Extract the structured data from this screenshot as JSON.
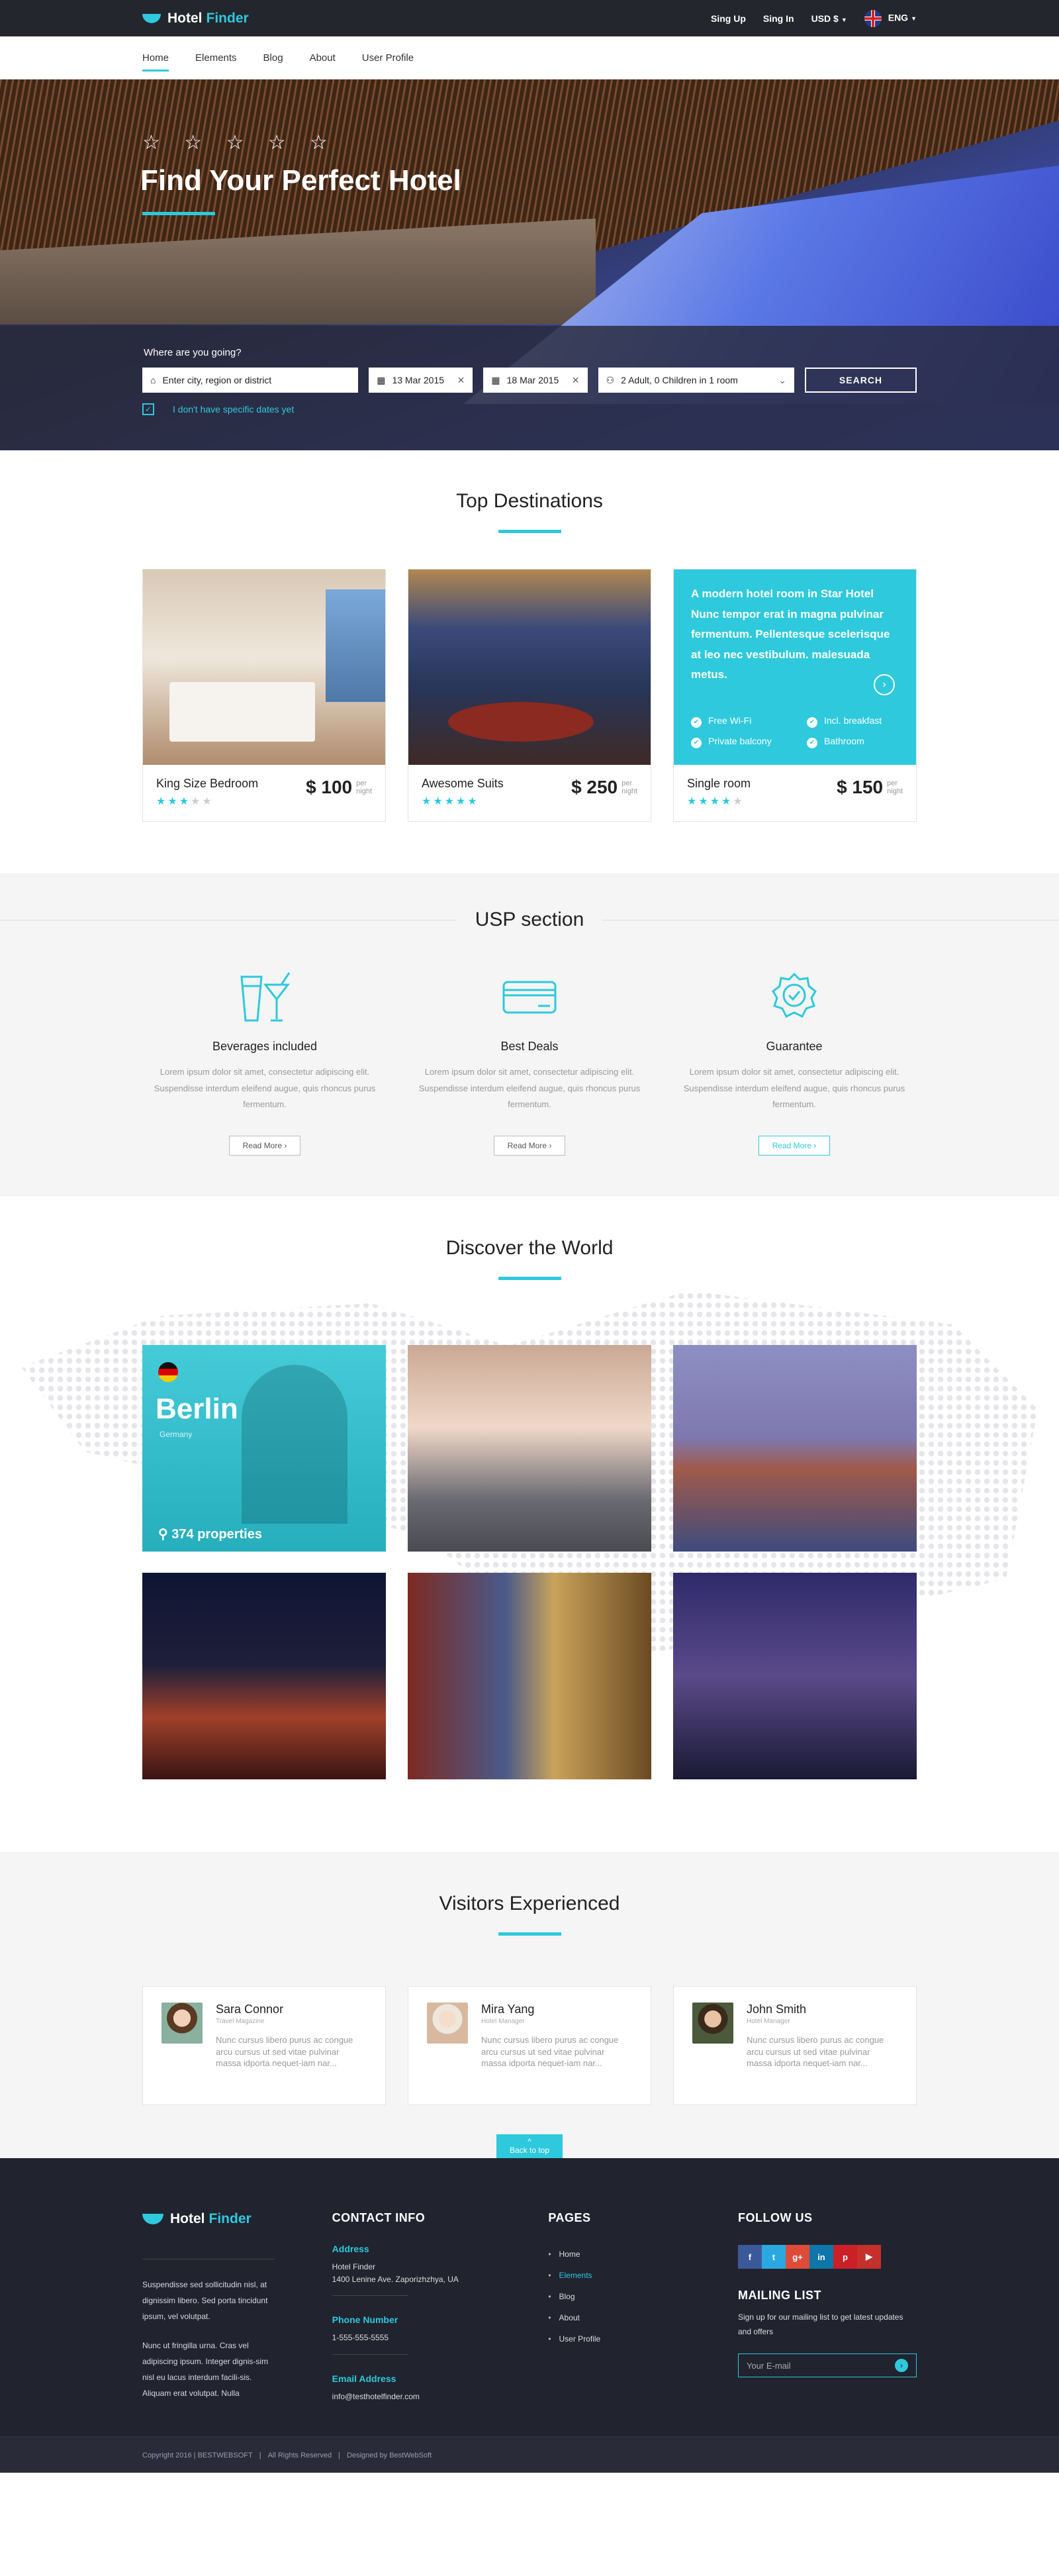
{
  "brand": {
    "name": "Hotel",
    "accent": "Finder",
    "accent_color": "#2ec9dc"
  },
  "topbar": {
    "sign_up": "Sing Up",
    "sign_in": "Sing In",
    "currency": "USD $",
    "language": "ENG"
  },
  "nav": {
    "items": [
      "Home",
      "Elements",
      "Blog",
      "About",
      "User Profile"
    ],
    "active": "Home"
  },
  "hero": {
    "stars": "☆ ☆ ☆ ☆ ☆",
    "title": "Find Your Perfect Hotel",
    "search": {
      "question": "Where are you going?",
      "destination_placeholder": "Enter city, region or district",
      "checkin": "13 Mar 2015",
      "checkout": "18 Mar 2015",
      "guests": "2 Adult, 0 Children in 1 room",
      "button": "SEARCH",
      "no_dates": "I don't have specific dates yet"
    }
  },
  "top_destinations": {
    "title": "Top Destinations",
    "cards": [
      {
        "name": "King Size Bedroom",
        "price": "$ 100",
        "per": "per",
        "night": "night",
        "rating": 3
      },
      {
        "name": "Awesome Suits",
        "price": "$ 250",
        "per": "per",
        "night": "night",
        "rating": 5
      },
      {
        "name": "Single room",
        "price": "$ 150",
        "per": "per",
        "night": "night",
        "rating": 4
      }
    ],
    "promo": {
      "text": "A modern hotel room in Star Hotel Nunc tempor erat in magna pulvinar fermentum. Pellentesque scelerisque at leo nec vestibulum. malesuada metus.",
      "features": [
        "Free Wi-Fi",
        "Incl. breakfast",
        "Private balcony",
        "Bathroom"
      ]
    }
  },
  "usp": {
    "title": "USP section",
    "items": [
      {
        "title": "Beverages included",
        "text": "Lorem ipsum dolor sit amet, consectetur adipiscing elit. Suspendisse interdum eleifend augue, quis rhoncus purus fermentum.",
        "button": "Read More",
        "icon": "cocktail-icon"
      },
      {
        "title": "Best Deals",
        "text": "Lorem ipsum dolor sit amet, consectetur adipiscing elit. Suspendisse interdum eleifend augue, quis rhoncus purus fermentum.",
        "button": "Read More",
        "icon": "credit-card-icon"
      },
      {
        "title": "Guarantee",
        "text": "Lorem ipsum dolor sit amet, consectetur adipiscing elit. Suspendisse interdum eleifend augue, quis rhoncus purus fermentum.",
        "button": "Read More",
        "icon": "badge-check-icon"
      }
    ]
  },
  "discover": {
    "title": "Discover the World",
    "featured": {
      "city": "Berlin",
      "country": "Germany",
      "properties": "374 properties"
    }
  },
  "visitors": {
    "title": "Visitors Experienced",
    "items": [
      {
        "name": "Sara Connor",
        "role": "Travel Magazine",
        "text": "Nunc cursus libero purus ac congue arcu cursus ut sed vitae pulvinar massa idporta nequet-iam nar..."
      },
      {
        "name": "Mira Yang",
        "role": "Hotel Manager",
        "text": "Nunc cursus libero purus ac congue arcu cursus ut sed vitae pulvinar massa idporta nequet-iam nar..."
      },
      {
        "name": "John Smith",
        "role": "Hotel Manager",
        "text": "Nunc cursus libero purus ac congue arcu cursus ut sed vitae pulvinar massa idporta nequet-iam nar..."
      }
    ]
  },
  "back_to_top": "Back to top",
  "footer": {
    "about1": "Suspendisse sed sollicitudin nisl, at dignissim libero. Sed porta tincidunt ipsum, vel volutpat.",
    "about2": "Nunc ut fringilla urna. Cras vel adipiscing ipsum. Integer dignis-sim nisl eu lacus interdum facili-sis. Aliquam erat volutpat. Nulla",
    "contact": {
      "title": "CONTACT INFO",
      "address_label": "Address",
      "address1": "Hotel Finder",
      "address2": "1400 Lenine Ave. Zaporizhzhya, UA",
      "phone_label": "Phone Number",
      "phone": "1-555-555-5555",
      "email_label": "Email Address",
      "email": "info@testhotelfinder.com"
    },
    "pages": {
      "title": "PAGES",
      "items": [
        "Home",
        "Elements",
        "Blog",
        "About",
        "User Profile"
      ],
      "active": "Elements"
    },
    "follow": {
      "title": "FOLLOW US",
      "networks": [
        {
          "label": "f",
          "color": "#3b5998"
        },
        {
          "label": "t",
          "color": "#2aa9e0"
        },
        {
          "label": "g+",
          "color": "#dd4b39"
        },
        {
          "label": "in",
          "color": "#0e76a8"
        },
        {
          "label": "p",
          "color": "#cb2027"
        },
        {
          "label": "▶",
          "color": "#c4302b"
        }
      ]
    },
    "mailing": {
      "title": "MAILING LIST",
      "text": "Sign up for our mailing list to get latest updates and offers",
      "placeholder": "Your E-mail"
    },
    "copyright": "Copyright  2016  |  BESTWEBSOFT",
    "rights": "All Rights Reserved",
    "designed": "Designed by BestWebSoft"
  }
}
